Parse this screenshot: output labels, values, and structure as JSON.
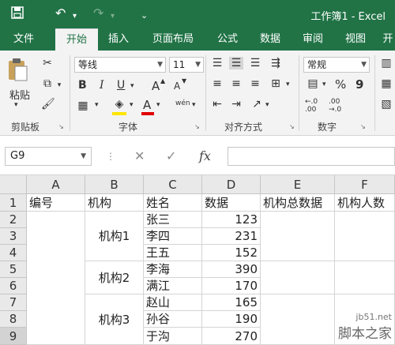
{
  "window": {
    "title": "工作簿1 - Excel"
  },
  "quick_access": {
    "save_icon": "save-icon",
    "undo_icon": "undo-icon",
    "redo_icon": "redo-icon",
    "customize_icon": "customize-icon"
  },
  "tabs": [
    {
      "label": "文件"
    },
    {
      "label": "开始"
    },
    {
      "label": "插入"
    },
    {
      "label": "页面布局"
    },
    {
      "label": "公式"
    },
    {
      "label": "数据"
    },
    {
      "label": "审阅"
    },
    {
      "label": "视图"
    },
    {
      "label": "开"
    }
  ],
  "ribbon": {
    "clipboard": {
      "paste_label": "粘贴",
      "group_label": "剪贴板"
    },
    "font": {
      "font_name": "等线",
      "font_size": "11",
      "bold": "B",
      "italic": "I",
      "underline": "U",
      "grow": "A",
      "shrink": "A",
      "font_color": "A",
      "phonetic": "wén",
      "group_label": "字体"
    },
    "alignment": {
      "group_label": "对齐方式"
    },
    "number": {
      "format": "常规",
      "percent": "%",
      "comma": "9",
      "group_label": "数字"
    }
  },
  "formula_bar": {
    "name_box": "G9",
    "fx": "fx",
    "value": ""
  },
  "sheet": {
    "columns": [
      "A",
      "B",
      "C",
      "D",
      "E",
      "F"
    ],
    "rows": [
      "1",
      "2",
      "3",
      "4",
      "5",
      "6",
      "7",
      "8",
      "9"
    ],
    "header_row": [
      "编号",
      "机构",
      "姓名",
      "数据",
      "机构总数据",
      "机构人数"
    ],
    "groups": [
      "机构1",
      "机构2",
      "机构3"
    ],
    "names": [
      "张三",
      "李四",
      "王五",
      "李海",
      "满江",
      "赵山",
      "孙谷",
      "于沟"
    ],
    "values": [
      "123",
      "231",
      "152",
      "390",
      "170",
      "165",
      "190",
      "270"
    ]
  },
  "watermark": {
    "site": "jb51.net",
    "brand": "脚本之家"
  },
  "colors": {
    "excel_green": "#217346",
    "ribbon_bg": "#f3f3f3",
    "header_bg": "#e9e9e9"
  }
}
